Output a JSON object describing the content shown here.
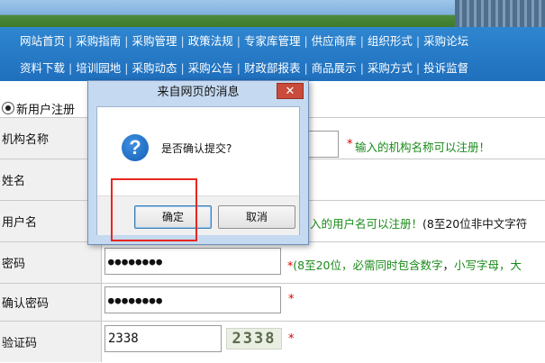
{
  "nav": {
    "row1": [
      "网站首页",
      "采购指南",
      "采购管理",
      "政策法规",
      "专家库管理",
      "供应商库",
      "组织形式",
      "采购论坛"
    ],
    "row2": [
      "资料下载",
      "培训园地",
      "采购动态",
      "采购公告",
      "财政部报表",
      "商品展示",
      "采购方式",
      "投诉监督"
    ],
    "separator": "|"
  },
  "form": {
    "new_user_label": "新用户注册",
    "org_name": {
      "label": "机构名称",
      "tip": "输入的机构名称可以注册！"
    },
    "name": {
      "label": "姓名"
    },
    "username": {
      "label": "用户名",
      "tip_green": "入的用户名可以注册！",
      "tip_black": "(8至20位非中文字符"
    },
    "password": {
      "label": "密码",
      "value": "●●●●●●●●",
      "tip_part1": "(8至20位，必需同时包含",
      "tip_part2": "数字",
      "tip_part3": "，",
      "tip_part4": "小写字母",
      "tip_part5": "，大"
    },
    "confirm_password": {
      "label": "确认密码",
      "value": "●●●●●●●●"
    },
    "captcha": {
      "label": "验证码",
      "value": "2338",
      "image_text": "2338"
    },
    "required_mark": "*"
  },
  "dialog": {
    "title": "来自网页的消息",
    "close_glyph": "✕",
    "message": "是否确认提交?",
    "icon_glyph": "?",
    "ok_label": "确定",
    "cancel_label": "取消"
  },
  "colors": {
    "nav_bg": "#1f6fbd",
    "tip_green": "#1a8a1a",
    "required_red": "#e00000",
    "highlight_red": "#e8261f",
    "dialog_frame": "#c5d9f1"
  }
}
